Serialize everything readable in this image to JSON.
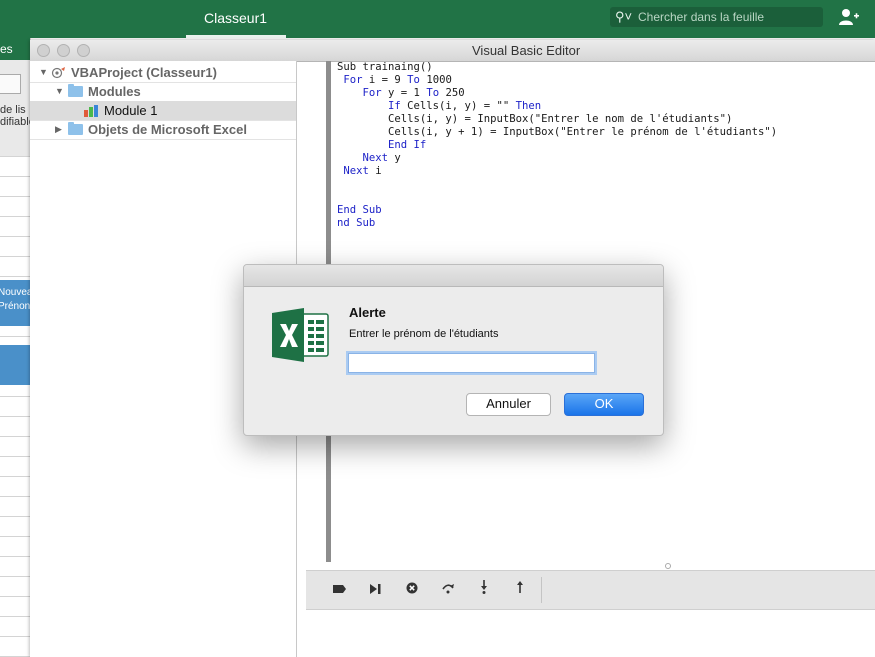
{
  "excel": {
    "title": "Classeur1",
    "search_placeholder": "Chercher dans la feuille",
    "ribbon_fragment": "es",
    "desc_line1": "de lis",
    "desc_line2": "difiable",
    "blue_line1": "Nouvea",
    "blue_line2": "Prénon"
  },
  "vbe": {
    "title": "Visual Basic Editor",
    "tree": {
      "project": "VBAProject (Classeur1)",
      "modules": "Modules",
      "module1": "Module 1",
      "objects": "Objets de Microsoft Excel"
    },
    "code": {
      "l1": "Sub trainaing()",
      "l2_a": " For",
      "l2_b": " i = 9 ",
      "l2_c": "To",
      "l2_d": " 1000",
      "l3_a": "    For",
      "l3_b": " y = 1 ",
      "l3_c": "To",
      "l3_d": " 250",
      "l4_a": "        If",
      "l4_b": " Cells(i, y) = \"\" ",
      "l4_c": "Then",
      "l5": "        Cells(i, y) = InputBox(\"Entrer le nom de l'étudiants\")",
      "l6": "        Cells(i, y + 1) = InputBox(\"Entrer le prénom de l'étudiants\")",
      "l7": "        End If",
      "l8_a": "    Next",
      "l8_b": " y",
      "l9_a": " Next",
      "l9_b": " i",
      "l12": "End Sub",
      "l13": "nd Sub"
    }
  },
  "dialog": {
    "title": "Alerte",
    "message": "Entrer le prénom de l'étudiants",
    "input_value": "",
    "cancel_label": "Annuler",
    "ok_label": "OK"
  },
  "colors": {
    "excel_green": "#217346",
    "keyword_blue": "#1e23c8",
    "ok_blue": "#1a74e9"
  }
}
